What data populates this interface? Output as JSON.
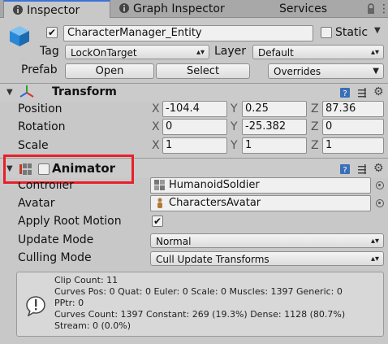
{
  "tabs": [
    {
      "label": "Inspector",
      "icon": "info-icon",
      "active": true
    },
    {
      "label": "Graph Inspector",
      "icon": "graph-icon",
      "active": false
    },
    {
      "label": "Services",
      "icon": "",
      "active": false
    }
  ],
  "header": {
    "object_name": "CharacterManager_Entity",
    "active": true,
    "static_label": "Static",
    "tag_label": "Tag",
    "tag_value": "LockOnTarget",
    "layer_label": "Layer",
    "layer_value": "Default",
    "prefab_label": "Prefab",
    "open_label": "Open",
    "select_label": "Select",
    "overrides_label": "Overrides"
  },
  "transform": {
    "title": "Transform",
    "rows": [
      {
        "label": "Position",
        "x": "-104.4",
        "y": "0.25",
        "z": "87.36"
      },
      {
        "label": "Rotation",
        "x": "0",
        "y": "-25.382",
        "z": "0"
      },
      {
        "label": "Scale",
        "x": "1",
        "y": "1",
        "z": "1"
      }
    ],
    "axis": {
      "x": "X",
      "y": "Y",
      "z": "Z"
    }
  },
  "animator": {
    "title": "Animator",
    "enabled": true,
    "controller_label": "Controller",
    "controller_value": "HumanoidSoldier",
    "avatar_label": "Avatar",
    "avatar_value": "CharactersAvatar",
    "apply_root_label": "Apply Root Motion",
    "apply_root_checked": true,
    "update_mode_label": "Update Mode",
    "update_mode_value": "Normal",
    "culling_mode_label": "Culling Mode",
    "culling_mode_value": "Cull Update Transforms",
    "info_lines": [
      "Clip Count: 11",
      "Curves Pos: 0 Quat: 0 Euler: 0 Scale: 0 Muscles: 1397 Generic: 0",
      "PPtr: 0",
      "Curves Count: 1397 Constant: 269 (19.3%) Dense: 1128 (80.7%)",
      "Stream: 0 (0.0%)"
    ]
  },
  "colors": {
    "highlight": "#e8202a",
    "accent": "#3a72d8"
  }
}
